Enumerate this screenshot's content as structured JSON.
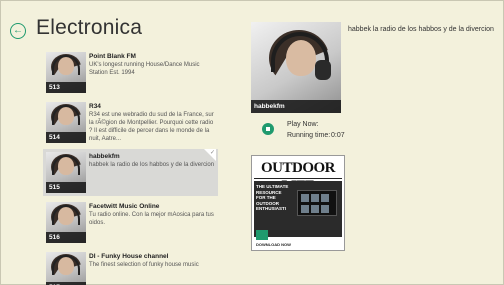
{
  "page": {
    "title": "Electronica",
    "back_icon": "back-arrow-icon"
  },
  "stations": [
    {
      "number": "513",
      "name": "Point Blank FM",
      "description": "UK's longest running House/Dance Music Station Est. 1994",
      "selected": false
    },
    {
      "number": "514",
      "name": "R34",
      "description": "R34 est une webradio du sud de la France, sur la rÃ©gion de Montpellier. Pourquoi cette radio ? Il est difficile de percer dans le monde de la nuit, Aatre...",
      "selected": false
    },
    {
      "number": "515",
      "name": "habbekfm",
      "description": "habbek la radio de los habbos y de la divercion",
      "selected": true
    },
    {
      "number": "516",
      "name": "Facetwitt Music Online",
      "description": "Tu radio online. Con la mejor mAosica para tus oidos.",
      "selected": false
    },
    {
      "number": "517",
      "name": "DI - Funky House channel",
      "description": "The finest selection of funky house music",
      "selected": false
    }
  ],
  "detail": {
    "caption": "habbekfm",
    "description": "habbek la radio de los habbos y de la divercion",
    "play_label": "Play Now:",
    "running_label": "Running time:",
    "running_time": "0:07"
  },
  "ad": {
    "logo_text": "OUTDOOR LIFE",
    "tagline": "THE ULTIMATE RESOURCE FOR THE OUTDOOR ENTHUSIASTI",
    "cta": "DOWNLOAD NOW"
  },
  "colors": {
    "background": "#f3f1dc",
    "accent": "#1f9a6e",
    "selected": "#d9d9d6"
  }
}
